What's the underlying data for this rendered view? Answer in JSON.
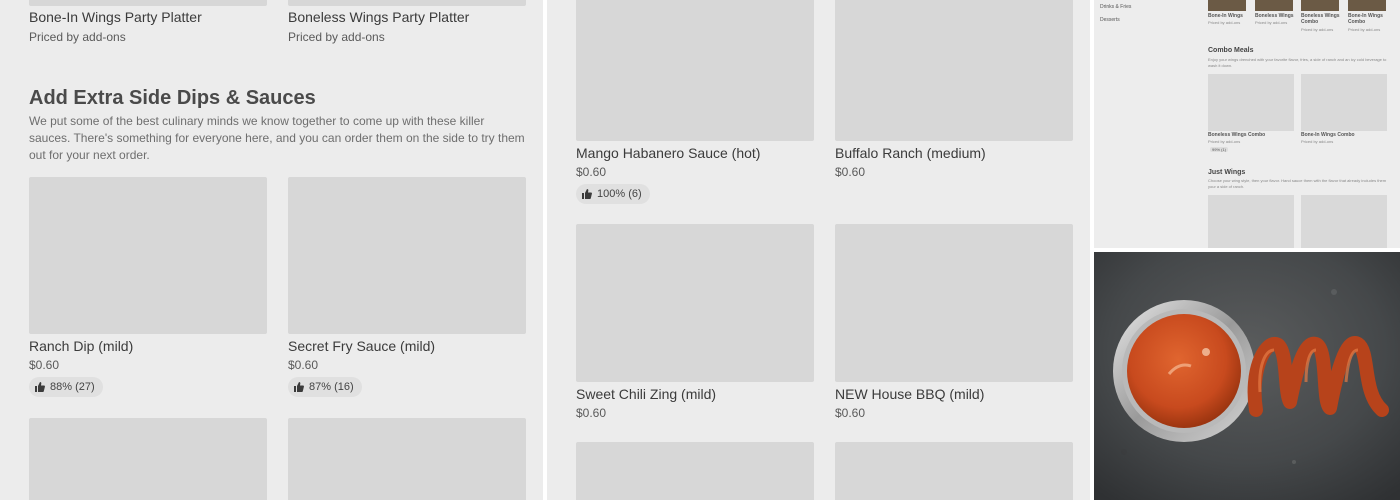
{
  "left": {
    "top_items": [
      {
        "name": "Bone-In Wings Party Platter",
        "price": "Priced by add-ons"
      },
      {
        "name": "Boneless Wings Party Platter",
        "price": "Priced by add-ons"
      }
    ],
    "section_title": "Add Extra Side Dips & Sauces",
    "section_desc": "We put some of the best culinary minds we know together to come up with these killer sauces. There's something for everyone here, and you can order them on the side to try them out for your next order.",
    "items": [
      {
        "name": "Ranch Dip (mild)",
        "price": "$0.60",
        "rating": "88% (27)"
      },
      {
        "name": "Secret Fry Sauce (mild)",
        "price": "$0.60",
        "rating": "87% (16)"
      }
    ]
  },
  "middle": {
    "items": [
      {
        "name": "Mango Habanero Sauce (hot)",
        "price": "$0.60",
        "rating": "100% (6)"
      },
      {
        "name": "Buffalo Ranch (medium)",
        "price": "$0.60"
      },
      {
        "name": "Sweet Chili Zing (mild)",
        "price": "$0.60"
      },
      {
        "name": "NEW House BBQ (mild)",
        "price": "$0.60"
      }
    ]
  },
  "mini": {
    "sidebar": [
      "Drinks & Fries",
      "Desserts"
    ],
    "top_items": [
      {
        "name": "Bone-In Wings",
        "price": "Priced by add-ons"
      },
      {
        "name": "Boneless Wings",
        "price": "Priced by add-ons"
      },
      {
        "name": "Boneless Wings Combo",
        "price": "Priced by add-ons"
      },
      {
        "name": "Bone-In Wings Combo",
        "price": "Priced by add-ons"
      }
    ],
    "combo_title": "Combo Meals",
    "combo_desc": "Enjoy your wings drenched with your favorite flavor, fries, a side of ranch and an icy cold beverage to wash it down.",
    "combo_items": [
      {
        "name": "Boneless Wings Combo",
        "price": "Priced by add-ons",
        "rating": "99% (1)"
      },
      {
        "name": "Bone-In Wings Combo",
        "price": "Priced by add-ons"
      }
    ],
    "just_title": "Just Wings",
    "just_desc": "Choose your wing style, then your flavor. Hand sauce them with the flavor that already includes them your a side of ranch."
  },
  "colors": {
    "panel_bg": "#ececec",
    "placeholder": "#d7d7d7",
    "sauce": "#c84a1e"
  }
}
